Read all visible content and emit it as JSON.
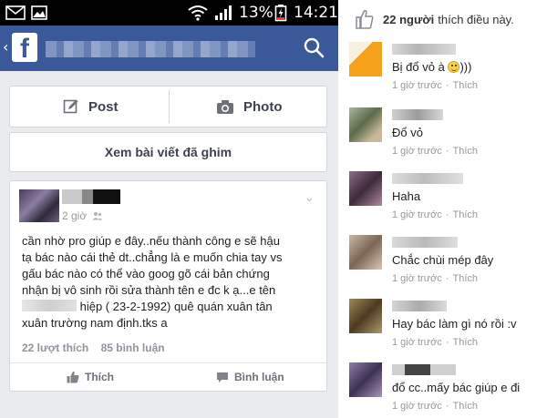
{
  "status_bar": {
    "battery": "13%",
    "time": "14:21"
  },
  "app_bar": {
    "back_glyph": "‹",
    "logo_letter": "f"
  },
  "composer": {
    "post_label": "Post",
    "photo_label": "Photo"
  },
  "pinned": {
    "label": "Xem bài viết đã ghim"
  },
  "post": {
    "time": "2 giờ",
    "body_lines": [
      "cần nhờ pro giúp e đây..nếu thành công e sẽ hậu",
      "tạ bác nào cái thẻ dt..chẳng là e muốn chia tay vs",
      "gấu bác nào có thể vào goog gõ cái bản chứng",
      "nhận bị vô sinh rồi sửa thành tên e đc k ạ...e tên"
    ],
    "body_line5_rest": " hiệp ( 23-2-1992) quê quán xuân tân",
    "body_line6": "xuân trường nam định.tks a",
    "likes_count": "22 lượt thích",
    "comments_count": "85 bình luận",
    "like_button": "Thích",
    "comment_button": "Bình luận"
  },
  "comments_panel": {
    "likes_summary_bold": "22 người",
    "likes_summary_rest": "thích điều này.",
    "items": [
      {
        "text": "Bị đổ vỏ à ",
        "text_suffix": ")))",
        "time": "1 giờ trước",
        "like": "Thích",
        "avatar_color": "#f4a21c"
      },
      {
        "text": "Đổ vỏ",
        "text_suffix": "",
        "time": "1 giờ trước",
        "like": "Thích",
        "avatar_color": "#6c7a5a"
      },
      {
        "text": "Haha",
        "text_suffix": "",
        "time": "1 giờ trước",
        "like": "Thích",
        "avatar_color": "#5a3e4e"
      },
      {
        "text": "Chắc chùi mép đây",
        "text_suffix": "",
        "time": "1 giờ trước",
        "like": "Thích",
        "avatar_color": "#8a7868"
      },
      {
        "text": "Hay bác làm gì nó rồi :v",
        "text_suffix": "",
        "time": "1 giờ trước",
        "like": "Thích",
        "avatar_color": "#5c4a2e"
      },
      {
        "text": "đổ cc..mấy bác giúp e đi",
        "text_suffix": "",
        "time": "1 giờ trước",
        "like": "Thích",
        "avatar_color": "#5a4c6e"
      }
    ]
  }
}
